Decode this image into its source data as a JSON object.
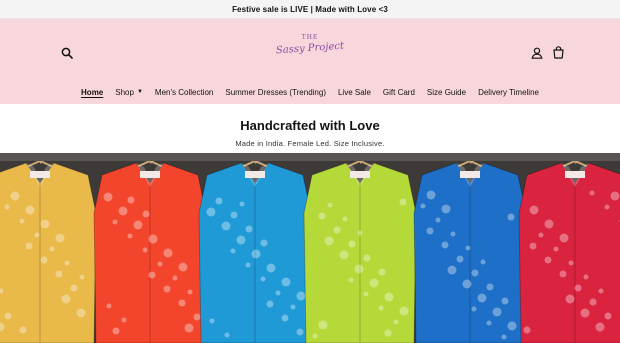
{
  "announcement": {
    "text": "Festive sale is LIVE | Made with Love <3"
  },
  "header": {
    "logo_top": "THE",
    "logo_main": "Sassy Project",
    "search_icon": "search-icon",
    "account_icon": "account-icon",
    "cart_icon": "cart-icon",
    "background": "#f8d7dc"
  },
  "nav": {
    "items": [
      {
        "label": "Home",
        "active": true
      },
      {
        "label": "Shop",
        "dropdown": true
      },
      {
        "label": "Men's Collection"
      },
      {
        "label": "Summer Dresses (Trending)"
      },
      {
        "label": "Live Sale"
      },
      {
        "label": "Gift Card"
      },
      {
        "label": "Size Guide"
      },
      {
        "label": "Delivery Timeline"
      }
    ]
  },
  "tagline": {
    "title": "Handcrafted with Love",
    "subtitle": "Made in India. Female Led. Size Inclusive."
  },
  "hero": {
    "shirt_colors": [
      "#e9b94a",
      "#f2452c",
      "#1f9ad6",
      "#b6d93a",
      "#1e6fc7",
      "#d9233f"
    ]
  }
}
